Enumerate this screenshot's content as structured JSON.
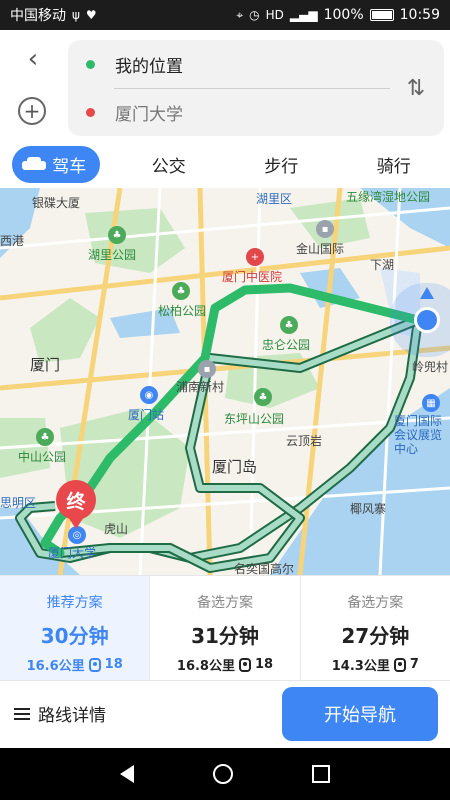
{
  "status": {
    "carrier": "中国移动",
    "battery": "100%",
    "time": "10:59",
    "icons": [
      "usb-icon",
      "heart-icon",
      "location-icon",
      "alarm-icon",
      "hd-icon",
      "signal-icon",
      "battery-icon"
    ]
  },
  "route": {
    "origin": "我的位置",
    "destination": "厦门大学",
    "origin_color": "#2dbb6a",
    "destination_color": "#e8474c"
  },
  "tabs": [
    {
      "label": "驾车",
      "active": true
    },
    {
      "label": "公交",
      "active": false
    },
    {
      "label": "步行",
      "active": false
    },
    {
      "label": "骑行",
      "active": false
    }
  ],
  "map": {
    "labels": {
      "yinju": "银碟大厦",
      "hulidistrict": "湖里区",
      "wuyuan": "五缘湾湿地公园",
      "xixigang": "西港",
      "huli_park": "湖里公园",
      "jinshan": "金山国际",
      "xiadian": "下湖",
      "zhongyi": "厦门中医院",
      "songbai": "松柏公园",
      "zhonglun": "忠仑公园",
      "xiamen": "厦门",
      "punan": "浦南新村",
      "lingdou": "岭兜村",
      "xiamen_station": "厦门站",
      "dongping": "东坪山公园",
      "yunding": "云顶岩",
      "intl_center": "厦门国际会议展览中心",
      "zhongshan": "中山公园",
      "xiamen_island": "厦门岛",
      "siming": "思明区",
      "yefeng": "椰风寨",
      "hushan": "虎山",
      "xmu": "厦门大学",
      "mingkui": "名奕国高尔",
      "end_marker": "终"
    }
  },
  "options": [
    {
      "label": "推荐方案",
      "time": "30分钟",
      "distance": "16.6公里",
      "lights": "18",
      "active": true
    },
    {
      "label": "备选方案",
      "time": "31分钟",
      "distance": "16.8公里",
      "lights": "18",
      "active": false
    },
    {
      "label": "备选方案",
      "time": "27分钟",
      "distance": "14.3公里",
      "lights": "7",
      "active": false
    }
  ],
  "actions": {
    "detail": "路线详情",
    "start": "开始导航"
  },
  "colors": {
    "accent": "#3f86f5",
    "route_primary": "#2dbb6a",
    "route_alt": "#a8dcc6"
  }
}
